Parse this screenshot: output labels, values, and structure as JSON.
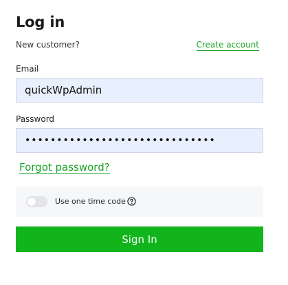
{
  "header": {
    "title": "Log in",
    "new_customer_text": "New customer?",
    "create_account_label": "Create account"
  },
  "form": {
    "email_label": "Email",
    "email_value": "quickWpAdmin",
    "password_label": "Password",
    "password_value": "••••••••••••••••••••••••••••••",
    "forgot_password_label": "Forgot password?",
    "one_time_code_label": "Use one time code",
    "one_time_code_enabled": false,
    "sign_in_label": "Sign In"
  },
  "colors": {
    "accent_green": "#1aa328",
    "button_green": "#11b41a",
    "field_background": "#e8effd"
  },
  "icons": {
    "help": "question-circle-icon"
  }
}
